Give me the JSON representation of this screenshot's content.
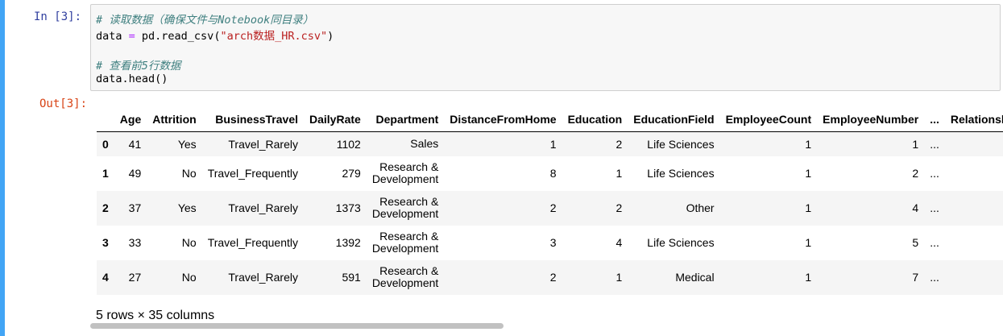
{
  "in_prompt": "In [3]:",
  "out_prompt": "Out[3]:",
  "code": {
    "comment1": "# 读取数据（确保文件与Notebook同目录）",
    "line2_prefix": "data ",
    "line2_op": "=",
    "line2_mid": " pd.read_csv(",
    "line2_str": "\"arch数据_HR.csv\"",
    "line2_end": ")",
    "comment2": "# 查看前5行数据",
    "line4": "data.head()"
  },
  "table": {
    "columns": [
      "",
      "Age",
      "Attrition",
      "BusinessTravel",
      "DailyRate",
      "Department",
      "DistanceFromHome",
      "Education",
      "EducationField",
      "EmployeeCount",
      "EmployeeNumber",
      "...",
      "RelationshipSatisfaction"
    ],
    "rows": [
      [
        "0",
        "41",
        "Yes",
        "Travel_Rarely",
        "1102",
        "Sales",
        "1",
        "2",
        "Life Sciences",
        "1",
        "1",
        "..."
      ],
      [
        "1",
        "49",
        "No",
        "Travel_Frequently",
        "279",
        "Research & Development",
        "8",
        "1",
        "Life Sciences",
        "1",
        "2",
        "..."
      ],
      [
        "2",
        "37",
        "Yes",
        "Travel_Rarely",
        "1373",
        "Research & Development",
        "2",
        "2",
        "Other",
        "1",
        "4",
        "..."
      ],
      [
        "3",
        "33",
        "No",
        "Travel_Frequently",
        "1392",
        "Research & Development",
        "3",
        "4",
        "Life Sciences",
        "1",
        "5",
        "..."
      ],
      [
        "4",
        "27",
        "No",
        "Travel_Rarely",
        "591",
        "Research & Development",
        "2",
        "1",
        "Medical",
        "1",
        "7",
        "..."
      ]
    ]
  },
  "shape_text": "5 rows × 35 columns"
}
